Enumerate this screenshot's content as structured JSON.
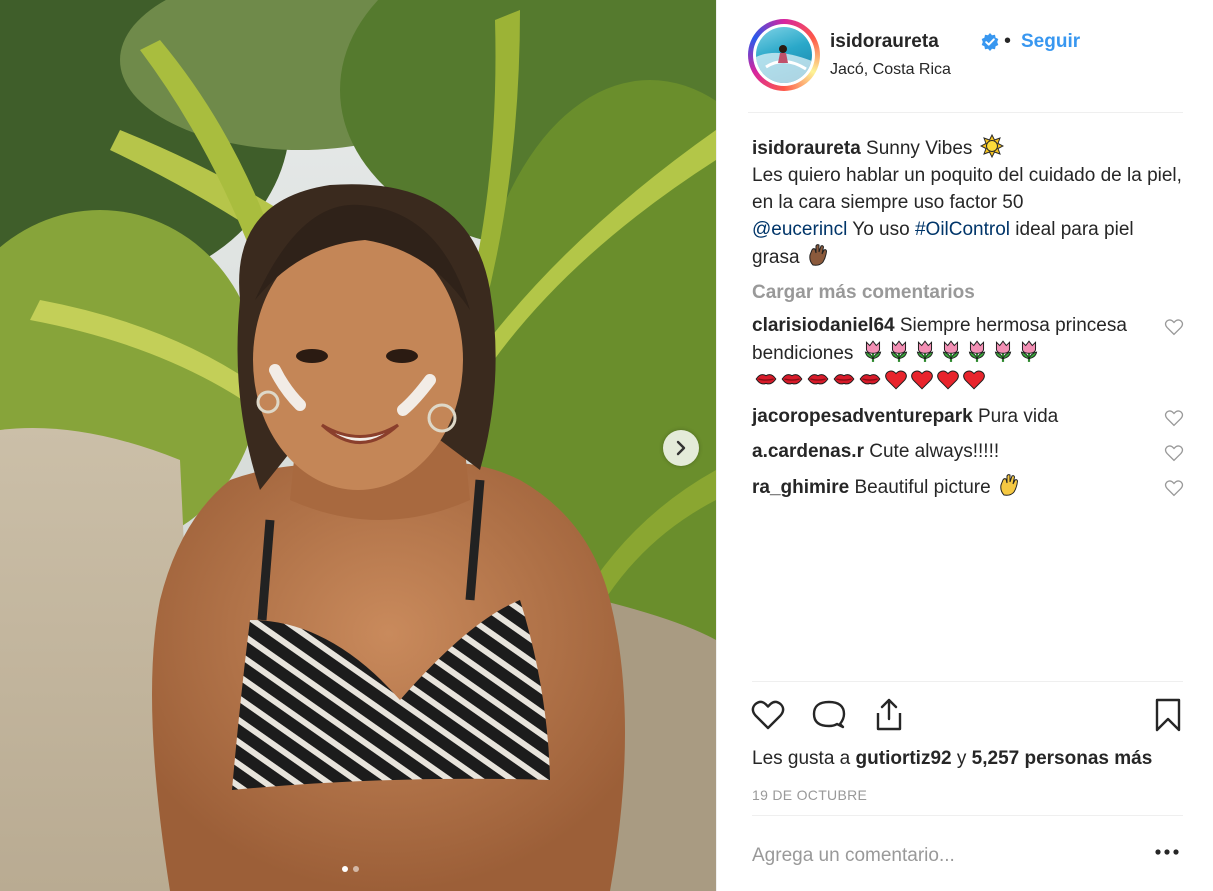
{
  "header": {
    "username": "isidoraureta",
    "verified": true,
    "follow_label": "Seguir",
    "separator": "•",
    "location": "Jacó, Costa Rica"
  },
  "caption": {
    "username": "isidoraureta",
    "text_line1": "Sunny Vibes",
    "text_body": "Les quiero hablar un poquito del cuidado de la piel, en la cara siempre uso factor 50",
    "mention": "@eucerincl",
    "text_mid": "Yo uso",
    "hashtag": "#OilControl",
    "text_end": "ideal para piel grasa"
  },
  "load_more_label": "Cargar más comentarios",
  "comments": [
    {
      "username": "clarisiodaniel64",
      "text": "Siempre hermosa princesa bendiciones"
    },
    {
      "username": "jacoropesadventurepark",
      "text": "Pura vida"
    },
    {
      "username": "a.cardenas.r",
      "text": "Cute always!!!!!"
    },
    {
      "username": "ra_ghimire",
      "text": "Beautiful picture"
    }
  ],
  "likes": {
    "prefix": "Les gusta a",
    "user": "gutiortiz92",
    "joiner": "y",
    "count_text": "5,257 personas más"
  },
  "date": "19 DE OCTUBRE",
  "add_comment_placeholder": "Agrega un comentario...",
  "carousel": {
    "total": 2,
    "active": 0
  },
  "colors": {
    "link_blue": "#3897f0",
    "mention_blue": "#003569",
    "muted": "#999999",
    "text": "#262626"
  },
  "icons": [
    "verified-badge-icon",
    "chevron-right-icon",
    "heart-icon",
    "comment-icon",
    "share-icon",
    "bookmark-icon",
    "more-options-icon",
    "sun-emoji",
    "tulip-emoji",
    "kiss-emoji",
    "red-heart-emoji",
    "ok-hand-emoji"
  ]
}
